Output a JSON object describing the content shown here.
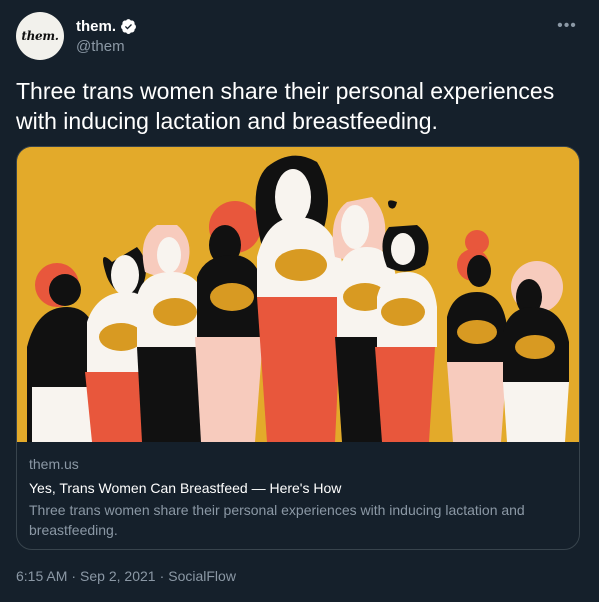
{
  "author": {
    "avatar_text": "them.",
    "display_name": "them.",
    "handle": "@them",
    "verified": true
  },
  "tweet": {
    "text": "Three trans women share their personal experiences with inducing lactation and breastfeeding."
  },
  "card": {
    "domain": "them.us",
    "title": "Yes, Trans Women Can Breastfeed — Here's How",
    "description": "Three trans women share their personal experiences with inducing lactation and breastfeeding."
  },
  "meta": {
    "time": "6:15 AM",
    "date": "Sep 2, 2021",
    "source": "SocialFlow",
    "separator": "·"
  },
  "colors": {
    "background": "#15202b",
    "card_border": "#38444d",
    "secondary_text": "#8b98a5",
    "illustration_bg": "#e3aa2a",
    "verified": "#ffffff"
  },
  "icons": {
    "verified": "verified-badge-icon",
    "more": "more-dots-icon"
  }
}
